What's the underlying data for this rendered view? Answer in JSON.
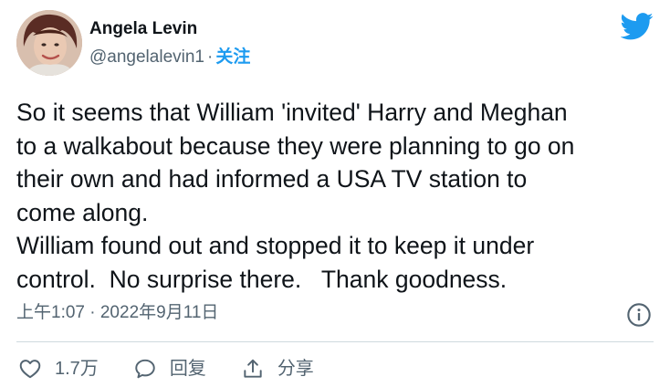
{
  "author": {
    "display_name": "Angela Levin",
    "handle": "@angelalevin1",
    "separator": "·",
    "follow_label": "关注",
    "avatar_icon": "profile-photo"
  },
  "brand_icon": "twitter-bird-icon",
  "tweet": {
    "text": "So it seems that William 'invited' Harry and Meghan\nto a walkabout because they were planning to go on\ntheir own and had informed a USA TV station to\ncome along.\nWilliam found out and stopped it to keep it under\ncontrol.  No surprise there.   Thank goodness.",
    "timestamp": "上午1:07 · 2022年9月11日"
  },
  "actions": {
    "like_count": "1.7万",
    "reply_label": "回复",
    "share_label": "分享"
  },
  "colors": {
    "accent": "#1d9bf0",
    "text": "#0f1419",
    "secondary": "#536471",
    "divider": "#cfd9de"
  }
}
